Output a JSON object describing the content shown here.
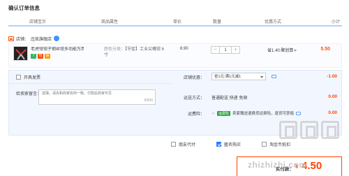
{
  "page": {
    "title": "确认订单信息"
  },
  "columns": [
    "店铺宝贝",
    "商品属性",
    "单价",
    "数量",
    "优惠方式",
    "小计"
  ],
  "shop": {
    "label": "店铺：",
    "name": "庄凯旗舰店"
  },
  "item": {
    "name": "老虎钳钳子钢丝钳多功能万用老...",
    "attr_label": "颜色分类：",
    "attr_value": "【节促】工业尖嘴钳 6寸",
    "unit_price": "6.90",
    "quantity": "1",
    "minus": "−",
    "plus": "+",
    "promo": "省1.40:聚划算",
    "subtotal": "5.50",
    "badges": [
      {
        "text": "7",
        "color": "#2db55d"
      },
      {
        "text": "包",
        "color": "#f40"
      },
      {
        "text": "保",
        "color": "#ff9a00"
      }
    ]
  },
  "invoice": {
    "label": "开具发票"
  },
  "message": {
    "label": "给卖家留言：",
    "placeholder": "选填，请先和商家协商一致，付款后商家可见",
    "counter": "0/200"
  },
  "discount": {
    "label": "店铺优惠：",
    "selected": "省1元:满1元减1",
    "value": "-1.00"
  },
  "shipping": {
    "label": "运送方式：",
    "method": "普通配送 快递 免邮",
    "value": "0.00"
  },
  "insurance": {
    "label": "运费险：",
    "tag": "运费险",
    "text": "卖家赠送退换货运费险，退货可获赔",
    "value": "0.00"
  },
  "options": [
    {
      "label": "朋友代付",
      "checked": false
    },
    {
      "label": "匿名购买",
      "checked": true
    },
    {
      "label": "淘金币抵扣",
      "checked": false
    }
  ],
  "total": {
    "label": "实付款：",
    "currency": "¥",
    "amount": "4.50"
  },
  "watermark": {
    "text": "zhizhizhi.com"
  }
}
